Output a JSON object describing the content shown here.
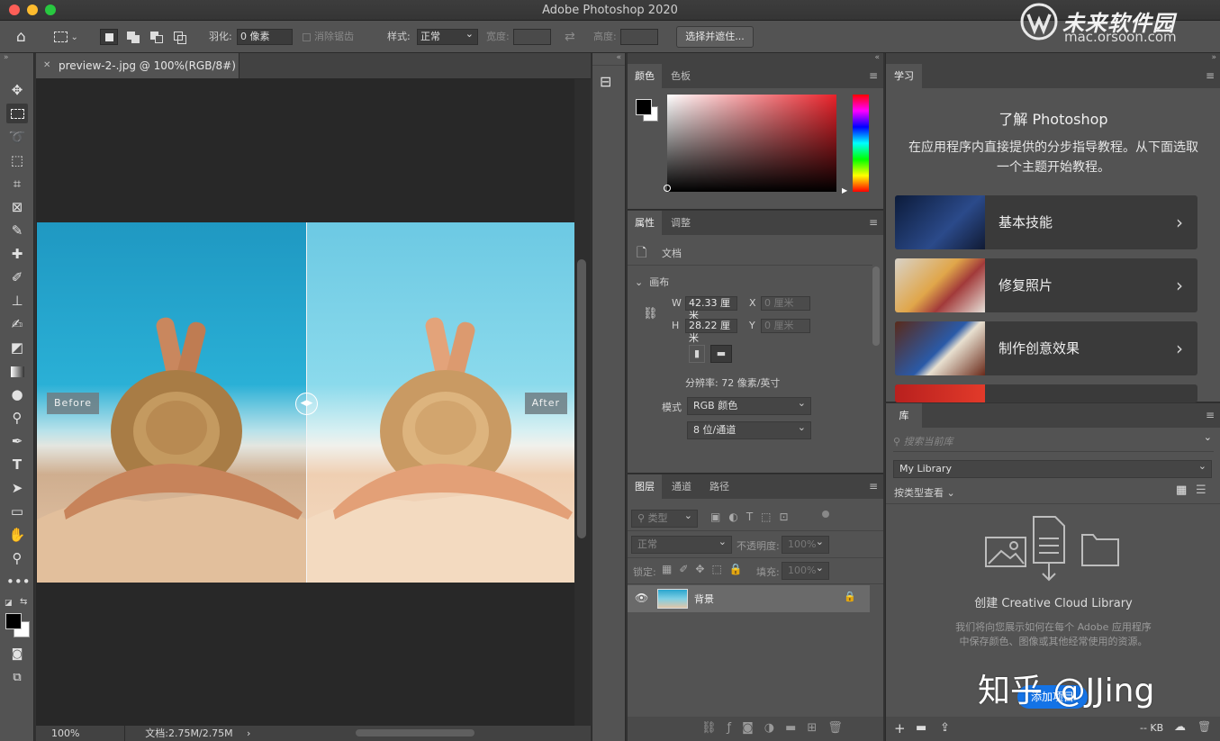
{
  "window": {
    "title": "Adobe Photoshop 2020"
  },
  "watermark": {
    "name": "未来软件园",
    "url": "mac.orsoon.com"
  },
  "options_bar": {
    "feather_label": "羽化:",
    "feather_value": "0 像素",
    "antialias_label": "消除锯齿",
    "style_label": "样式:",
    "style_value": "正常",
    "width_label": "宽度:",
    "height_label": "高度:",
    "select_mask_button": "选择并遮住..."
  },
  "document": {
    "tab_title": "preview-2-.jpg @ 100%(RGB/8#)",
    "before_label": "Before",
    "after_label": "After",
    "zoom": "100%",
    "doc_info": "文档:2.75M/2.75M"
  },
  "color_panel": {
    "tabs": [
      "颜色",
      "色板"
    ],
    "fg_color": "#000000",
    "bg_color": "#ffffff"
  },
  "properties_panel": {
    "tabs": [
      "属性",
      "调整"
    ],
    "type_label": "文档",
    "section_title": "画布",
    "w_label": "W",
    "w_value": "42.33 厘米",
    "h_label": "H",
    "h_value": "28.22 厘米",
    "x_label": "X",
    "x_placeholder": "0 厘米",
    "y_label": "Y",
    "y_placeholder": "0 厘米",
    "resolution": "分辨率: 72 像素/英寸",
    "mode_label": "模式",
    "mode_value": "RGB 颜色",
    "depth_value": "8 位/通道"
  },
  "layers_panel": {
    "tabs": [
      "图层",
      "通道",
      "路径"
    ],
    "filter_placeholder": "类型",
    "blend_mode": "正常",
    "opacity_label": "不透明度:",
    "opacity_value": "100%",
    "lock_label": "锁定:",
    "fill_label": "填充:",
    "fill_value": "100%",
    "layers": [
      {
        "name": "背景"
      }
    ]
  },
  "learn_panel": {
    "tab": "学习",
    "title": "了解 Photoshop",
    "description": "在应用程序内直接提供的分步指导教程。从下面选取一个主题开始教程。",
    "cards": [
      {
        "label": "基本技能"
      },
      {
        "label": "修复照片"
      },
      {
        "label": "制作创意效果"
      }
    ]
  },
  "library_panel": {
    "tab": "库",
    "search_placeholder": "搜索当前库",
    "library_name": "My Library",
    "view_by": "按类型查看",
    "empty_title": "创建 Creative Cloud Library",
    "empty_desc": "我们将向您展示如何在每个 Adobe 应用程序中保存颜色、图像或其他经常使用的资源。",
    "add_button": "添加项目",
    "size": "-- KB"
  },
  "overlay": {
    "text": "知乎 @JJing"
  }
}
